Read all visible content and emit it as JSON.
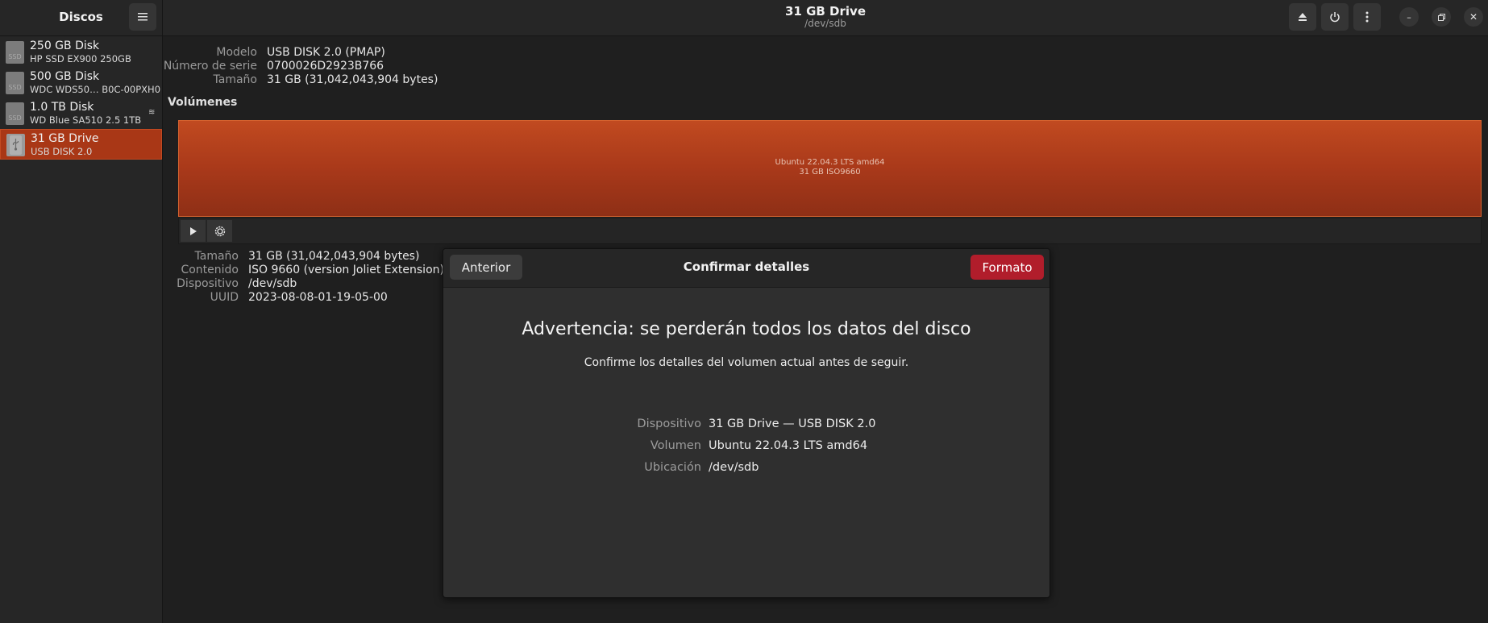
{
  "sidebar": {
    "title": "Discos",
    "menu_icon": "hamburger-menu-icon",
    "disks": [
      {
        "name": "250 GB Disk",
        "model": "HP SSD EX900 250GB",
        "icon": "ssd-icon",
        "icon_label": "SSD"
      },
      {
        "name": "500 GB Disk",
        "model": "WDC WDS50… B0C-00PXH0",
        "icon": "ssd-icon",
        "icon_label": "SSD"
      },
      {
        "name": "1.0 TB Disk",
        "model": "WD Blue SA510 2.5 1TB",
        "icon": "ssd-icon",
        "icon_label": "SSD"
      },
      {
        "name": "31 GB Drive",
        "model": "USB DISK 2.0",
        "icon": "usb-drive-icon",
        "selected": true
      }
    ]
  },
  "header": {
    "title": "31 GB Drive",
    "subtitle": "/dev/sdb"
  },
  "device_info": {
    "model_label": "Modelo",
    "model_value": "USB DISK 2.0 (PMAP)",
    "serial_label": "Número de serie",
    "serial_value": "0700026D2923B766",
    "size_label": "Tamaño",
    "size_value": "31 GB (31,042,043,904 bytes)"
  },
  "volumes": {
    "heading": "Volúmenes",
    "bar_label_1": "Ubuntu 22.04.3 LTS amd64",
    "bar_label_2": "31 GB ISO9660",
    "bar_color": "#a9391a"
  },
  "volume_info": {
    "size_label": "Tamaño",
    "size_value": "31 GB (31,042,043,904 bytes)",
    "content_label": "Contenido",
    "content_value": "ISO 9660 (version Joliet Extension) —",
    "device_label": "Dispositivo",
    "device_value": "/dev/sdb",
    "uuid_label": "UUID",
    "uuid_value": "2023-08-08-01-19-05-00"
  },
  "dialog": {
    "back_label": "Anterior",
    "title": "Confirmar detalles",
    "format_label": "Formato",
    "format_color": "#b11d2b",
    "warning": "Advertencia: se perderán todos los datos del disco",
    "sub": "Confirme los detalles del volumen actual antes de seguir.",
    "device_label": "Dispositivo",
    "device_value": "31 GB Drive — USB DISK 2.0",
    "volume_label": "Volumen",
    "volume_value": "Ubuntu 22.04.3 LTS amd64",
    "location_label": "Ubicación",
    "location_value": "/dev/sdb"
  }
}
